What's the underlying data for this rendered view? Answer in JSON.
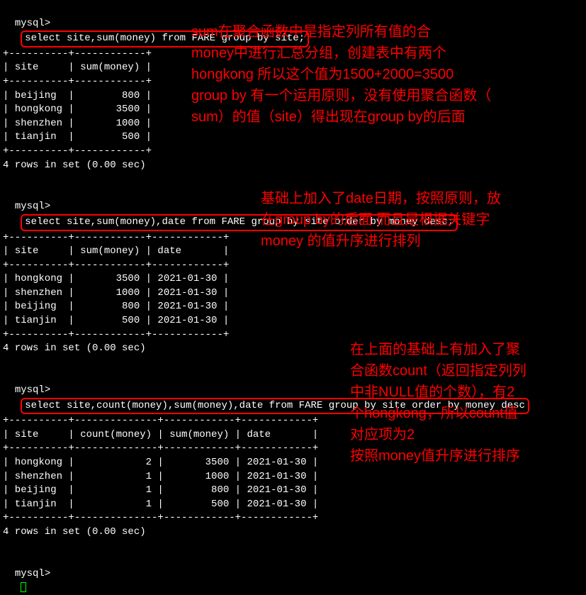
{
  "prompt": "mysql>",
  "queries": {
    "q1": "select site,sum(money) from FARE group by site;",
    "q2": "select site,sum(money),date from FARE group by site order by money desc;",
    "q3": "select site,count(money),sum(money),date from FARE group by site order by money desc"
  },
  "table1": {
    "sep": "+----------+------------+",
    "head": "| site     | sum(money) |",
    "rows": [
      "| beijing  |        800 |",
      "| hongkong |       3500 |",
      "| shenzhen |       1000 |",
      "| tianjin  |        500 |"
    ]
  },
  "table2": {
    "sep": "+----------+------------+------------+",
    "head": "| site     | sum(money) | date       |",
    "rows": [
      "| hongkong |       3500 | 2021-01-30 |",
      "| shenzhen |       1000 | 2021-01-30 |",
      "| beijing  |        800 | 2021-01-30 |",
      "| tianjin  |        500 | 2021-01-30 |"
    ]
  },
  "table3": {
    "sep": "+----------+--------------+------------+------------+",
    "head": "| site     | count(money) | sum(money) | date       |",
    "rows": [
      "| hongkong |            2 |       3500 | 2021-01-30 |",
      "| shenzhen |            1 |       1000 | 2021-01-30 |",
      "| beijing  |            1 |        800 | 2021-01-30 |",
      "| tianjin  |            1 |        500 | 2021-01-30 |"
    ]
  },
  "status": "4 rows in set (0.00 sec)",
  "annotations": {
    "a1_l1": "sum在聚合函数中是指定列所有值的合",
    "a1_l2": "money中进行汇总分组，创建表中有两个",
    "a1_l3": "hongkong 所以这个值为1500+2000=3500",
    "a1_l4": "group by 有一个运用原则，没有使用聚合函数（",
    "a1_l5": "sum）的值（site）得出现在group by的后面",
    "a2_l1": "基础上加入了date日期，按照原则，放",
    "a2_l2": "在group by的后面 而且是根据关键字",
    "a2_l3": "money 的值升序进行排列",
    "a3_l1": "在上面的基础上有加入了聚",
    "a3_l2": "合函数count（返回指定列列",
    "a3_l3": "中非NULL值的个数），有2",
    "a3_l4": "个hongkong，所以count值",
    "a3_l5": "对应项为2",
    "a3_l6": "按照money值升序进行排序"
  },
  "chart_data": [
    {
      "type": "table",
      "title": "select site,sum(money) from FARE group by site",
      "columns": [
        "site",
        "sum(money)"
      ],
      "rows": [
        [
          "beijing",
          800
        ],
        [
          "hongkong",
          3500
        ],
        [
          "shenzhen",
          1000
        ],
        [
          "tianjin",
          500
        ]
      ]
    },
    {
      "type": "table",
      "title": "select site,sum(money),date from FARE group by site order by money desc",
      "columns": [
        "site",
        "sum(money)",
        "date"
      ],
      "rows": [
        [
          "hongkong",
          3500,
          "2021-01-30"
        ],
        [
          "shenzhen",
          1000,
          "2021-01-30"
        ],
        [
          "beijing",
          800,
          "2021-01-30"
        ],
        [
          "tianjin",
          500,
          "2021-01-30"
        ]
      ]
    },
    {
      "type": "table",
      "title": "select site,count(money),sum(money),date from FARE group by site order by money desc",
      "columns": [
        "site",
        "count(money)",
        "sum(money)",
        "date"
      ],
      "rows": [
        [
          "hongkong",
          2,
          3500,
          "2021-01-30"
        ],
        [
          "shenzhen",
          1,
          1000,
          "2021-01-30"
        ],
        [
          "beijing",
          1,
          800,
          "2021-01-30"
        ],
        [
          "tianjin",
          1,
          500,
          "2021-01-30"
        ]
      ]
    }
  ]
}
